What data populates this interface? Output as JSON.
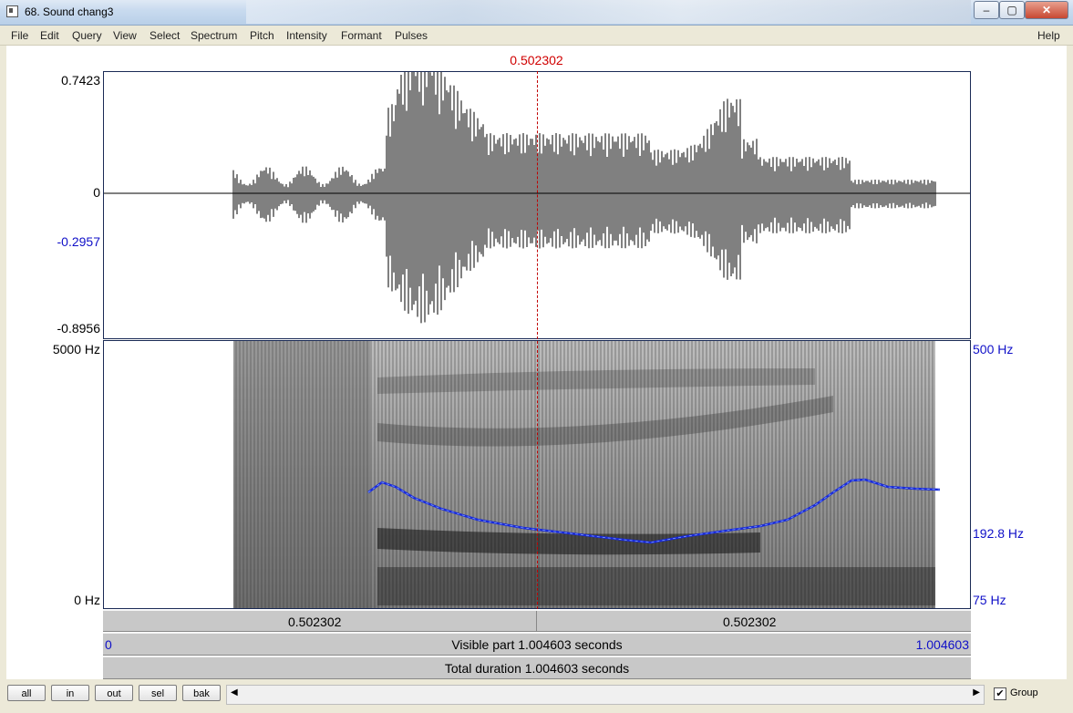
{
  "window": {
    "title": "68. Sound chang3",
    "controls": {
      "minimize": "‒",
      "maximize": "▢",
      "close": "✕"
    }
  },
  "menu": {
    "items": [
      "File",
      "Edit",
      "Query",
      "View",
      "Select",
      "Spectrum",
      "Pitch",
      "Intensity",
      "Formant",
      "Pulses"
    ],
    "help": "Help"
  },
  "cursor": {
    "time_label": "0.502302",
    "position_fraction": 0.5
  },
  "waveform": {
    "max_label": "0.7423",
    "zero_label": "0",
    "cursor_amp_label": "-0.2957",
    "min_label": "-0.8956"
  },
  "spectrogram": {
    "top_label": "5000 Hz",
    "bottom_label": "0 Hz"
  },
  "pitch": {
    "top_label": "500 Hz",
    "cursor_label": "192.8 Hz",
    "bottom_label": "75 Hz",
    "color": "#1a2ad8"
  },
  "time_strips": {
    "left_cursor_time": "0.502302",
    "right_cursor_time": "0.502302",
    "visible_start": "0",
    "visible_text": "Visible part 1.004603 seconds",
    "visible_end": "1.004603",
    "total_text": "Total duration 1.004603 seconds"
  },
  "bottom_bar": {
    "buttons": [
      "all",
      "in",
      "out",
      "sel",
      "bak"
    ],
    "scroll_left": "◀",
    "scroll_right": "▶",
    "group_checked": "✔",
    "group_label": "Group"
  }
}
